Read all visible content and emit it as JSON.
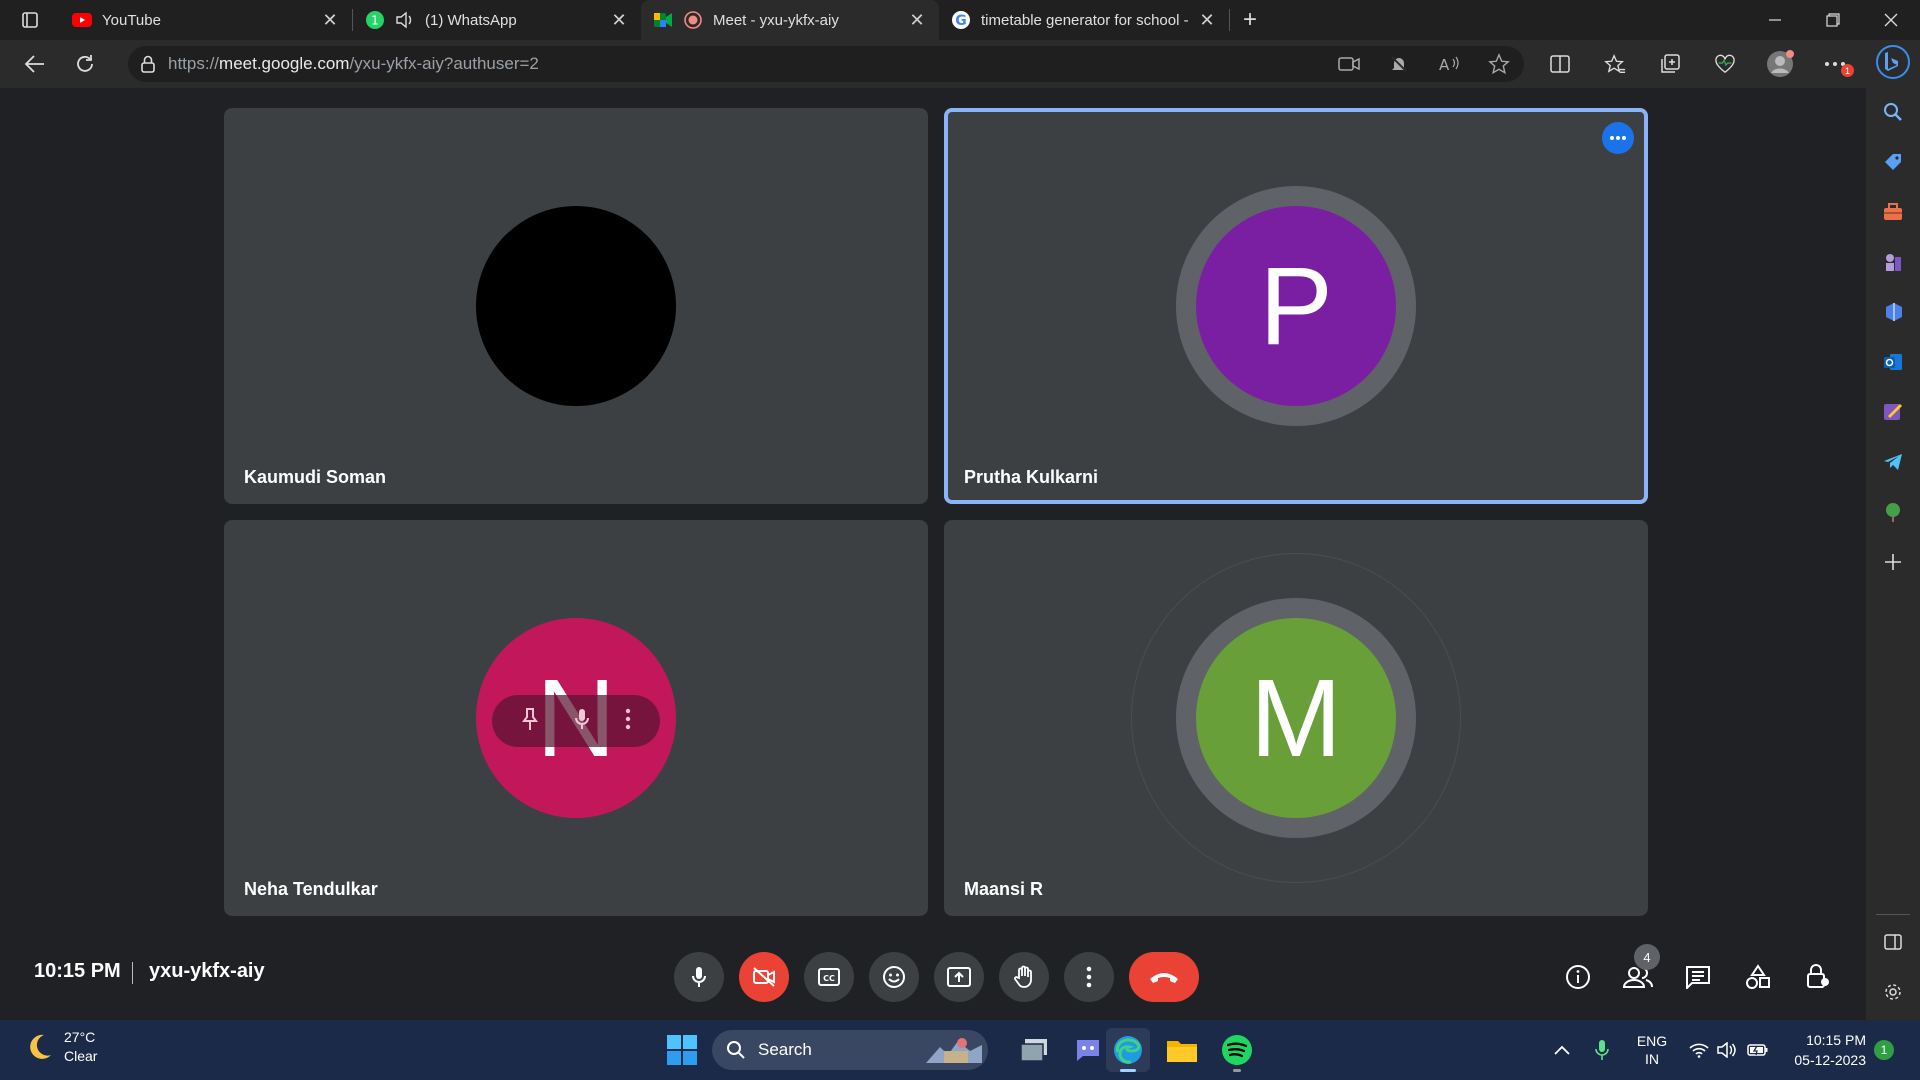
{
  "browser": {
    "tabs": [
      {
        "label": "YouTube",
        "favicon": "youtube-icon"
      },
      {
        "label": "(1) WhatsApp",
        "favicon": "whatsapp-icon",
        "badge": "1"
      },
      {
        "label": "Meet - yxu-ykfx-aiy",
        "favicon": "meet-icon",
        "active": true
      },
      {
        "label": "timetable generator for school -",
        "favicon": "google-icon"
      }
    ],
    "url_prefix": "https://",
    "url_host": "meet.google.com",
    "url_path": "/yxu-ykfx-aiy?authuser=2",
    "extension_badge": "1"
  },
  "meet": {
    "participants": [
      {
        "name": "Kaumudi Soman",
        "initial": "",
        "color": "#000000"
      },
      {
        "name": "Prutha Kulkarni",
        "initial": "P",
        "color": "#7b1fa2"
      },
      {
        "name": "Neha Tendulkar",
        "initial": "N",
        "color": "#c2185b"
      },
      {
        "name": "Maansi R",
        "initial": "M",
        "color": "#689f38"
      }
    ],
    "time": "10:15 PM",
    "separator": "|",
    "code": "yxu-ykfx-aiy",
    "people_count": "4"
  },
  "taskbar": {
    "temperature": "27°C",
    "weather": "Clear",
    "search_label": "Search",
    "language": "ENG",
    "region": "IN",
    "time": "10:15 PM",
    "date": "05-12-2023",
    "notifications": "1"
  }
}
